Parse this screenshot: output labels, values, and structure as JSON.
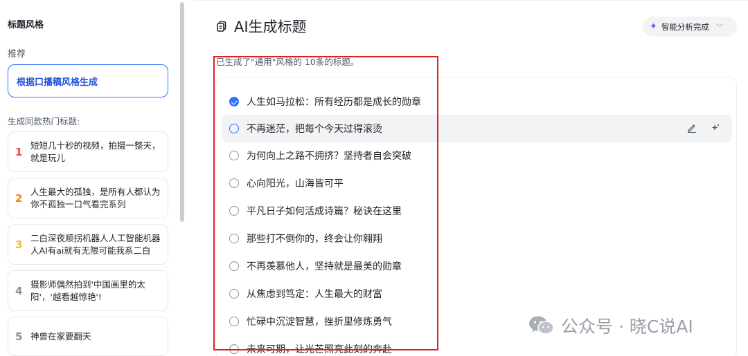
{
  "sidebar": {
    "heading": "标题风格",
    "recommend_label": "推荐",
    "recommend_button": "根据口播稿风格生成",
    "hot_label": "生成同款热门标题:",
    "hot_items": [
      {
        "rank": "1",
        "text": "短短几十秒的视频，拍摄一整天，就是玩儿",
        "color": "#f53f3f"
      },
      {
        "rank": "2",
        "text": "人生最大的孤独，是所有人都认为你不孤独一口气看完系列",
        "color": "#ff7d00"
      },
      {
        "rank": "3",
        "text": "二白深夜顺拐机器人人工智能机器人AI有ai就有无限可能我系二白",
        "color": "#f7ba1e"
      },
      {
        "rank": "4",
        "text": "摄影师偶然拍到'中国画里的太阳'，'越看越惊艳'!",
        "color": "#86909c"
      },
      {
        "rank": "5",
        "text": "神兽在家要翻天",
        "color": "#86909c"
      }
    ]
  },
  "main": {
    "title": "AI生成标题",
    "status_chip": "智能分析完成",
    "generated_text": "已生成了\"通用\"风格的 10条的标题。",
    "titles": [
      {
        "text": "人生如马拉松：所有经历都是成长的勋章",
        "state": "checked"
      },
      {
        "text": "不再迷茫，把每个今天过得滚烫",
        "state": "hover"
      },
      {
        "text": "为何向上之路不拥挤？坚持者自会突破",
        "state": "none"
      },
      {
        "text": "心向阳光，山海皆可平",
        "state": "none"
      },
      {
        "text": "平凡日子如何活成诗篇？秘诀在这里",
        "state": "none"
      },
      {
        "text": "那些打不倒你的，终会让你翱翔",
        "state": "none"
      },
      {
        "text": "不再羡慕他人，坚持就是最美的勋章",
        "state": "none"
      },
      {
        "text": "从焦虑到笃定：人生最大的财富",
        "state": "none"
      },
      {
        "text": "忙碌中沉淀智慧，挫折里修炼勇气",
        "state": "none"
      },
      {
        "text": "未来可期，让光芒照亮此刻的奔赴",
        "state": "none"
      }
    ]
  },
  "watermark": "公众号 · 晓C说AI",
  "colors": {
    "accent": "#3370ff",
    "annotation": "#e02020"
  }
}
